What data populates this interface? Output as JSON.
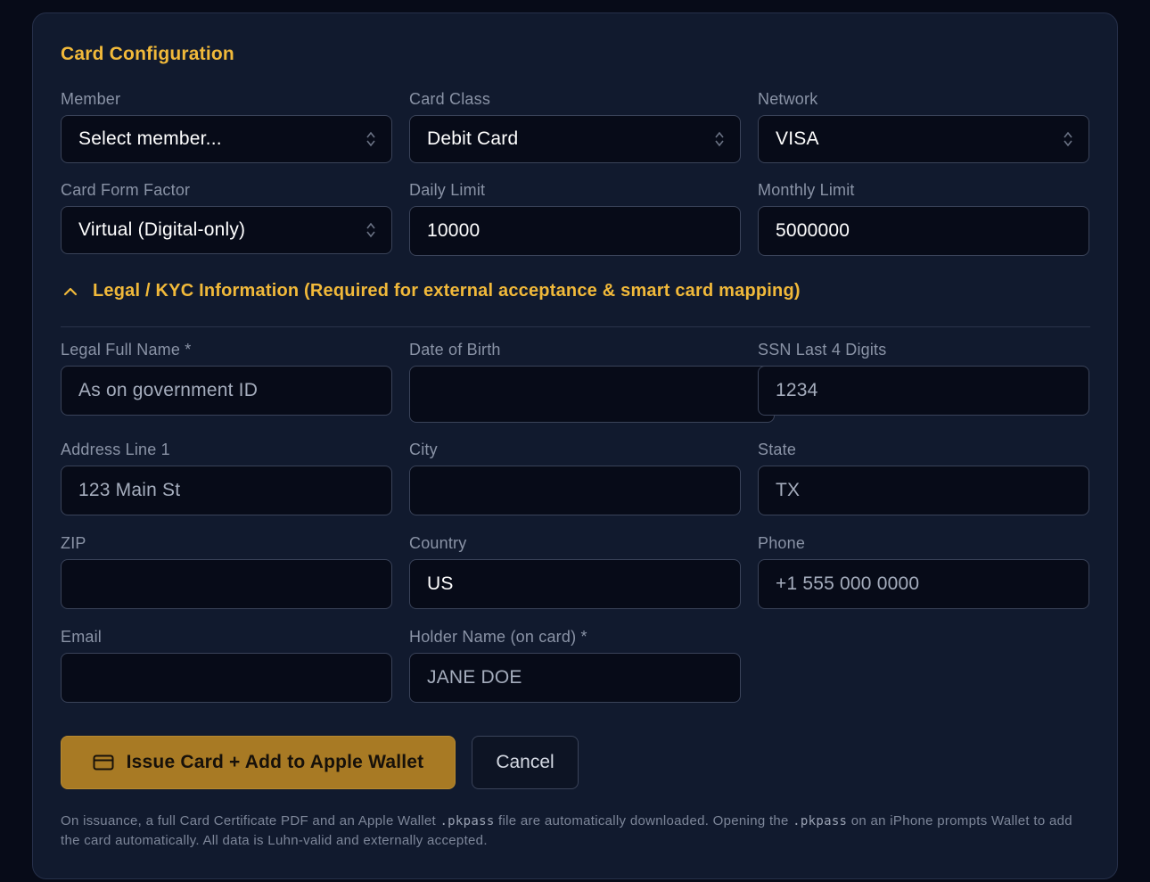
{
  "panel": {
    "title": "Card Configuration"
  },
  "config": {
    "member": {
      "label": "Member",
      "value": "Select member..."
    },
    "card_class": {
      "label": "Card Class",
      "value": "Debit Card"
    },
    "network": {
      "label": "Network",
      "value": "VISA"
    },
    "form_factor": {
      "label": "Card Form Factor",
      "value": "Virtual (Digital-only)"
    },
    "daily_limit": {
      "label": "Daily Limit",
      "value": "10000"
    },
    "monthly_limit": {
      "label": "Monthly Limit",
      "value": "5000000"
    }
  },
  "kyc": {
    "section_title": "Legal / KYC Information (Required for external acceptance & smart card mapping)",
    "expanded": true,
    "legal_name": {
      "label": "Legal Full Name *",
      "placeholder": "As on government ID",
      "value": ""
    },
    "dob": {
      "label": "Date of Birth",
      "value": ""
    },
    "ssn": {
      "label": "SSN Last 4 Digits",
      "placeholder": "1234",
      "value": ""
    },
    "address": {
      "label": "Address Line 1",
      "placeholder": "123 Main St",
      "value": ""
    },
    "city": {
      "label": "City",
      "value": ""
    },
    "state": {
      "label": "State",
      "placeholder": "TX",
      "value": ""
    },
    "zip": {
      "label": "ZIP",
      "value": ""
    },
    "country": {
      "label": "Country",
      "value": "US"
    },
    "phone": {
      "label": "Phone",
      "placeholder": "+1 555 000 0000",
      "value": ""
    },
    "email": {
      "label": "Email",
      "value": ""
    },
    "holder_name": {
      "label": "Holder Name (on card) *",
      "placeholder": "JANE DOE",
      "value": ""
    }
  },
  "actions": {
    "issue_label": "Issue Card + Add to Apple Wallet",
    "cancel_label": "Cancel"
  },
  "footnote": {
    "part1": "On issuance, a full Card Certificate PDF and an Apple Wallet ",
    "code1": ".pkpass",
    "part2": " file are automatically downloaded. Opening the ",
    "code2": ".pkpass",
    "part3": " on an iPhone prompts Wallet to add the card automatically. All data is Luhn-valid and externally accepted."
  },
  "colors": {
    "accent": "#f1b93a",
    "button_primary": "#a87a24",
    "panel_bg": "#111a2e",
    "page_bg": "#070b18"
  },
  "icons": {
    "select_arrows": "updown-arrows-icon",
    "section_toggle": "chevron-up-icon",
    "issue_button": "credit-card-icon"
  }
}
